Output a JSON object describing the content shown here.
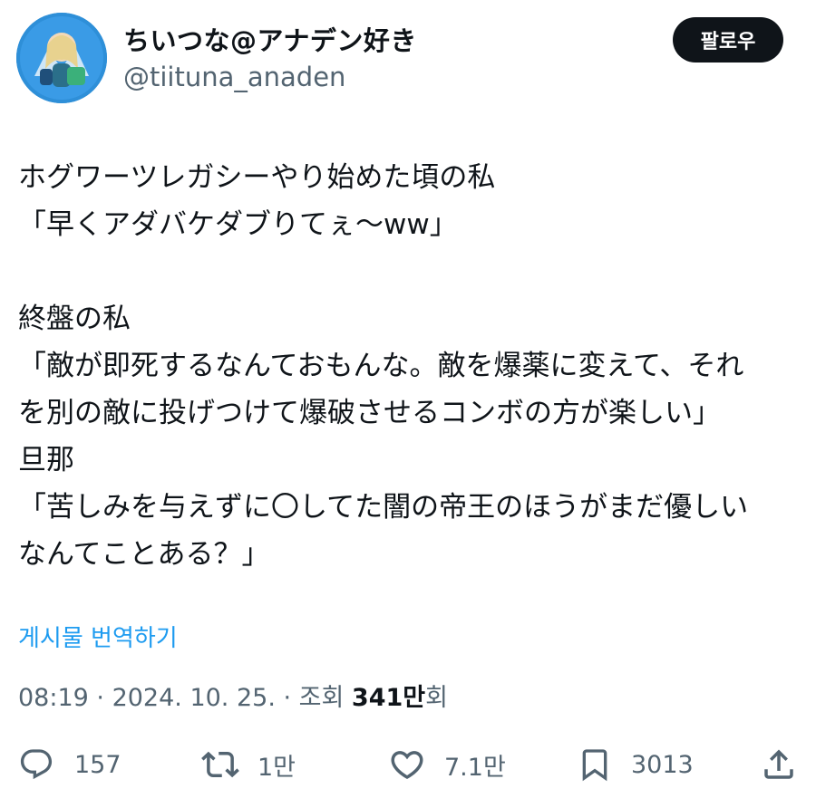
{
  "author": {
    "display_name": "ちいつな@アナデン好き",
    "handle": "@tiituna_anaden"
  },
  "follow_button": {
    "label": "팔로우"
  },
  "tweet": {
    "lines": [
      "ホグワーツレガシーやり始めた頃の私",
      "「早くアダバケダブりてぇ～ww」",
      "",
      "終盤の私",
      "「敵が即死するなんておもんな。敵を爆薬に変えて、それ",
      "を別の敵に投げつけて爆破させるコンボの方が楽しい」",
      "旦那",
      "「苦しみを与えずに〇してた闇の帝王のほうがまだ優しい",
      "なんてことある？」"
    ]
  },
  "translate_link": "게시물 번역하기",
  "meta": {
    "time": "08:19",
    "separator": " · ",
    "date": "2024. 10. 25.",
    "views_prefix": "조회 ",
    "views_count": "341만",
    "views_suffix": "회"
  },
  "actions": {
    "replies": {
      "icon": "reply-icon",
      "count": "157"
    },
    "retweets": {
      "icon": "retweet-icon",
      "count": "1만"
    },
    "likes": {
      "icon": "heart-icon",
      "count": "7.1만"
    },
    "bookmarks": {
      "icon": "bookmark-icon",
      "count": "3013"
    },
    "share": {
      "icon": "share-icon"
    }
  },
  "colors": {
    "text": "#0f1419",
    "secondary": "#536471",
    "link": "#1d9bf0",
    "button_bg": "#0f1419"
  }
}
